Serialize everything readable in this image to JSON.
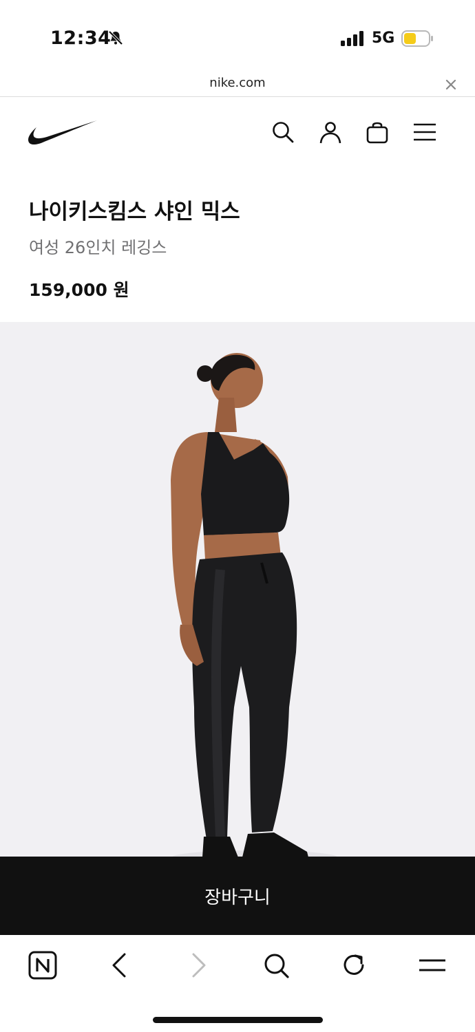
{
  "status_bar": {
    "time": "12:34",
    "network": "5G",
    "icons": [
      "bell-slash-icon",
      "signal-icon",
      "battery-icon"
    ]
  },
  "browser": {
    "url": "nike.com",
    "close_icon": "close-icon"
  },
  "site_header": {
    "logo": "nike-swoosh-logo",
    "icons": [
      "search-icon",
      "user-icon",
      "bag-icon",
      "menu-icon"
    ]
  },
  "product": {
    "title": "나이키스킴스 샤인 믹스",
    "subtitle": "여성 26인치 레깅스",
    "price": "159,000 원"
  },
  "cart": {
    "button_label": "장바구니"
  },
  "browser_toolbar": {
    "items": [
      "naver-home-icon",
      "back-icon",
      "forward-icon",
      "search-icon",
      "reload-icon",
      "menu-icon"
    ]
  },
  "colors": {
    "black": "#111111",
    "gray_text": "#707072",
    "image_bg": "#f1f0f3",
    "battery_fill": "#f5cc1a"
  }
}
